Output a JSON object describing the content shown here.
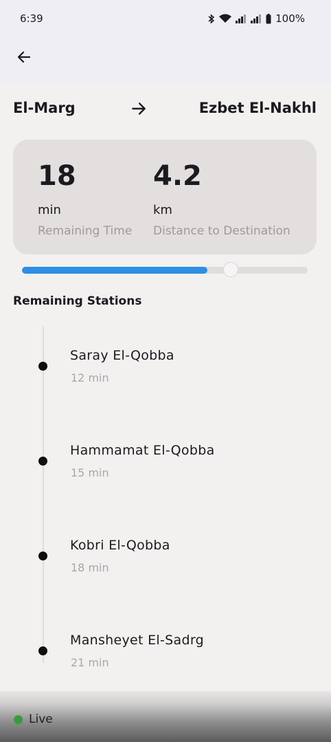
{
  "status_bar": {
    "time": "6:39",
    "battery": "100%",
    "icons": [
      "bluetooth-icon",
      "wifi-icon",
      "signal-icon",
      "signal-icon",
      "battery-icon"
    ]
  },
  "app_bar": {
    "back_icon": "arrow-left-icon"
  },
  "route": {
    "from": "El-Marg",
    "to": "Ezbet El-Nakhl",
    "arrow_icon": "arrow-right-icon"
  },
  "metrics": {
    "time": {
      "value": "18",
      "unit": "min",
      "label": "Remaining Time"
    },
    "distance": {
      "value": "4.2",
      "unit": "km",
      "label": "Distance to Destination"
    }
  },
  "progress": {
    "fraction": 0.65,
    "thumb_fraction": 0.73
  },
  "remaining_stations": {
    "title": "Remaining Stations",
    "items": [
      {
        "name": "Saray El-Qobba",
        "eta": "12 min"
      },
      {
        "name": "Hammamat El-Qobba",
        "eta": "15 min"
      },
      {
        "name": "Kobri El-Qobba",
        "eta": "18 min"
      },
      {
        "name": "Mansheyet El-Sadrg",
        "eta": "21 min"
      }
    ]
  },
  "live": {
    "label": "Live",
    "color": "#3a9a3f"
  },
  "colors": {
    "accent": "#2b8fe6",
    "card": "#e3dfdf",
    "background": "#f3f0f0"
  }
}
